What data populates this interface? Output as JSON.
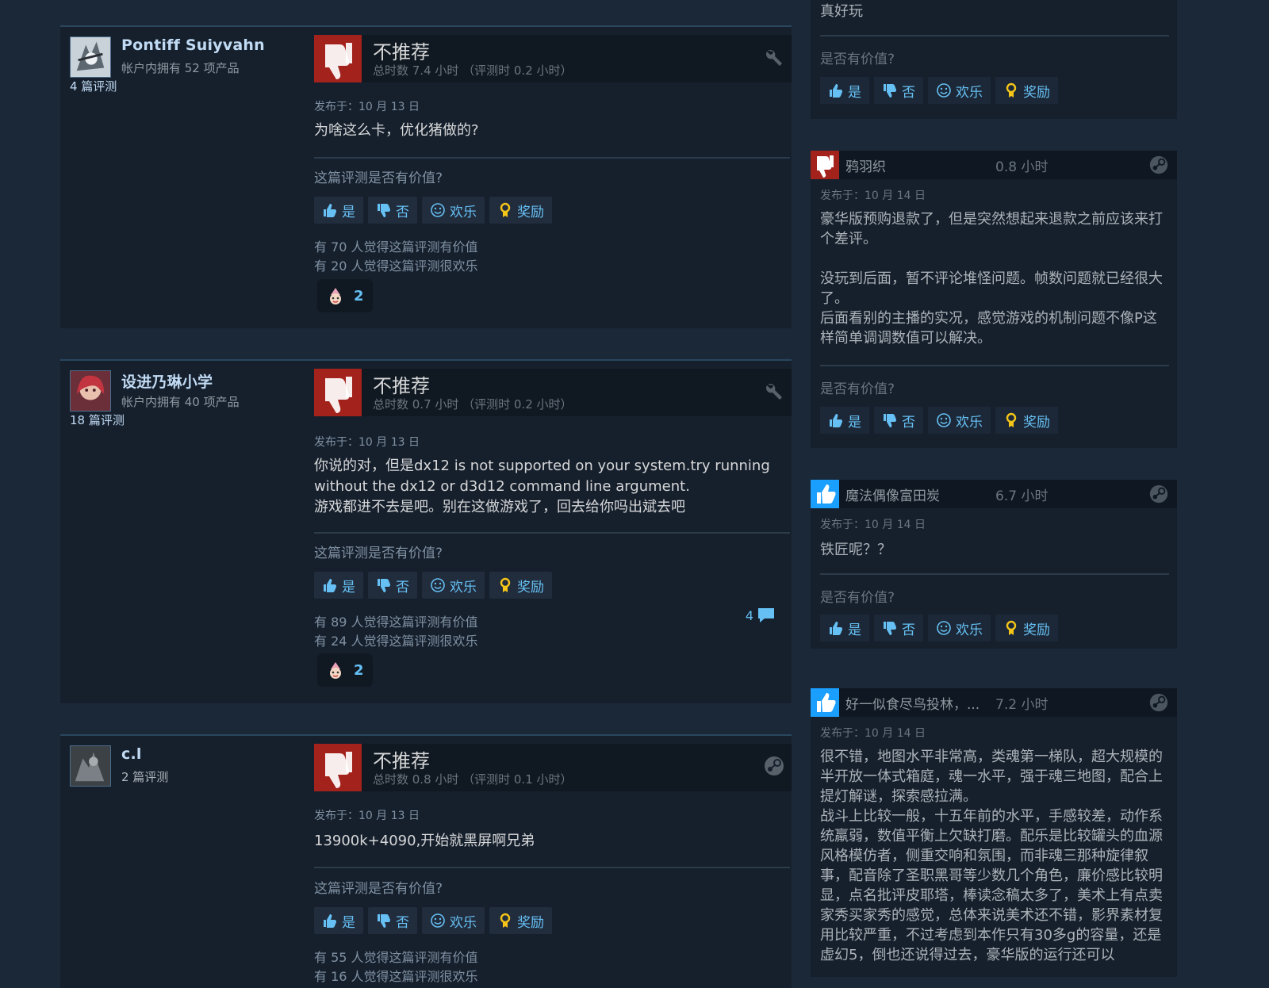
{
  "labels": {
    "helpful_question": "这篇评测是否有价值?",
    "helpful_question_short": "是否有价值?",
    "yes": "是",
    "no": "否",
    "funny": "欢乐",
    "award": "奖励"
  },
  "colors": {
    "not_recommended": "#a3221c",
    "recommended": "#1a9fff",
    "link": "#66c0f4",
    "award_gold": "#f5c518"
  },
  "reviews": [
    {
      "author": "Pontiff Suiyvahn",
      "products": "帐户内拥有 52 项产品",
      "review_count": "4 篇评测",
      "verdict": "不推荐",
      "hours": "总时数 7.4 小时 （评测时 0.2 小时）",
      "posted": "发布于：10 月 13 日",
      "text": "为啥这么卡，优化猪做的?",
      "helpful_count": "有 70 人觉得这篇评测有价值",
      "funny_count": "有 20 人觉得这篇评测很欢乐",
      "award_count": "2",
      "head_icon": "wrench-icon"
    },
    {
      "author": "设进乃琳小学",
      "products": "帐户内拥有 40 项产品",
      "review_count": "18 篇评测",
      "verdict": "不推荐",
      "hours": "总时数 0.7 小时 （评测时 0.2 小时）",
      "posted": "发布于：10 月 13 日",
      "text_lines": [
        "你说的对，但是dx12 is not supported on your system.try running",
        "without the dx12 or d3d12 command line argument.",
        "游戏都进不去是吧。别在这做游戏了，回去给你吗出斌去吧"
      ],
      "helpful_count": "有 89 人觉得这篇评测有价值",
      "funny_count": "有 24 人觉得这篇评测很欢乐",
      "award_count": "2",
      "comment_count": "4",
      "head_icon": "wrench-icon"
    },
    {
      "author": "c.l",
      "review_count": "2 篇评测",
      "verdict": "不推荐",
      "hours": "总时数 0.8 小时 （评测时 0.1 小时）",
      "posted": "发布于：10 月 13 日",
      "text": "13900k+4090,开始就黑屏啊兄弟",
      "helpful_count": "有 55 人觉得这篇评测有价值",
      "funny_count": "有 16 人觉得这篇评测很欢乐",
      "head_icon": "steam-icon"
    }
  ],
  "side_reviews": [
    {
      "text": "真好玩"
    },
    {
      "name": "鸦羽织",
      "hours": "0.8 小时",
      "recommended": false,
      "posted": "发布于：10 月 14 日",
      "paragraphs": [
        "豪华版预购退款了，但是突然想起来退款之前应该来打个差评。",
        "没玩到后面，暂不评论堆怪问题。帧数问题就已经很大了。\n后面看别的主播的实况，感觉游戏的机制问题不像P这样简单调调数值可以解决。"
      ]
    },
    {
      "name": "魔法偶像富田炭",
      "hours": "6.7 小时",
      "recommended": true,
      "posted": "发布于：10 月 14 日",
      "text": "铁匠呢？？"
    },
    {
      "name": "好一似食尽鸟投林，...",
      "hours": "7.2 小时",
      "recommended": true,
      "posted": "发布于：10 月 14 日",
      "text": "很不错，地图水平非常高，类魂第一梯队，超大规模的半开放一体式箱庭，魂一水平，强于魂三地图，配合上提灯解谜，探索感拉满。\n战斗上比较一般，十五年前的水平，手感较差，动作系统羸弱，数值平衡上欠缺打磨。配乐是比较罐头的血源风格模仿者，侧重交响和氛围，而非魂三那种旋律叙事，配音除了圣职黑哥等少数几个角色，廉价感比较明显，点名批评皮耶塔，棒读念稿太多了，美术上有点卖家秀买家秀的感觉，总体来说美术还不错，影界素材复用比较严重，不过考虑到本作只有30多g的容量，还是虚幻5，倒也还说得过去，豪华版的运行还可以"
    }
  ]
}
